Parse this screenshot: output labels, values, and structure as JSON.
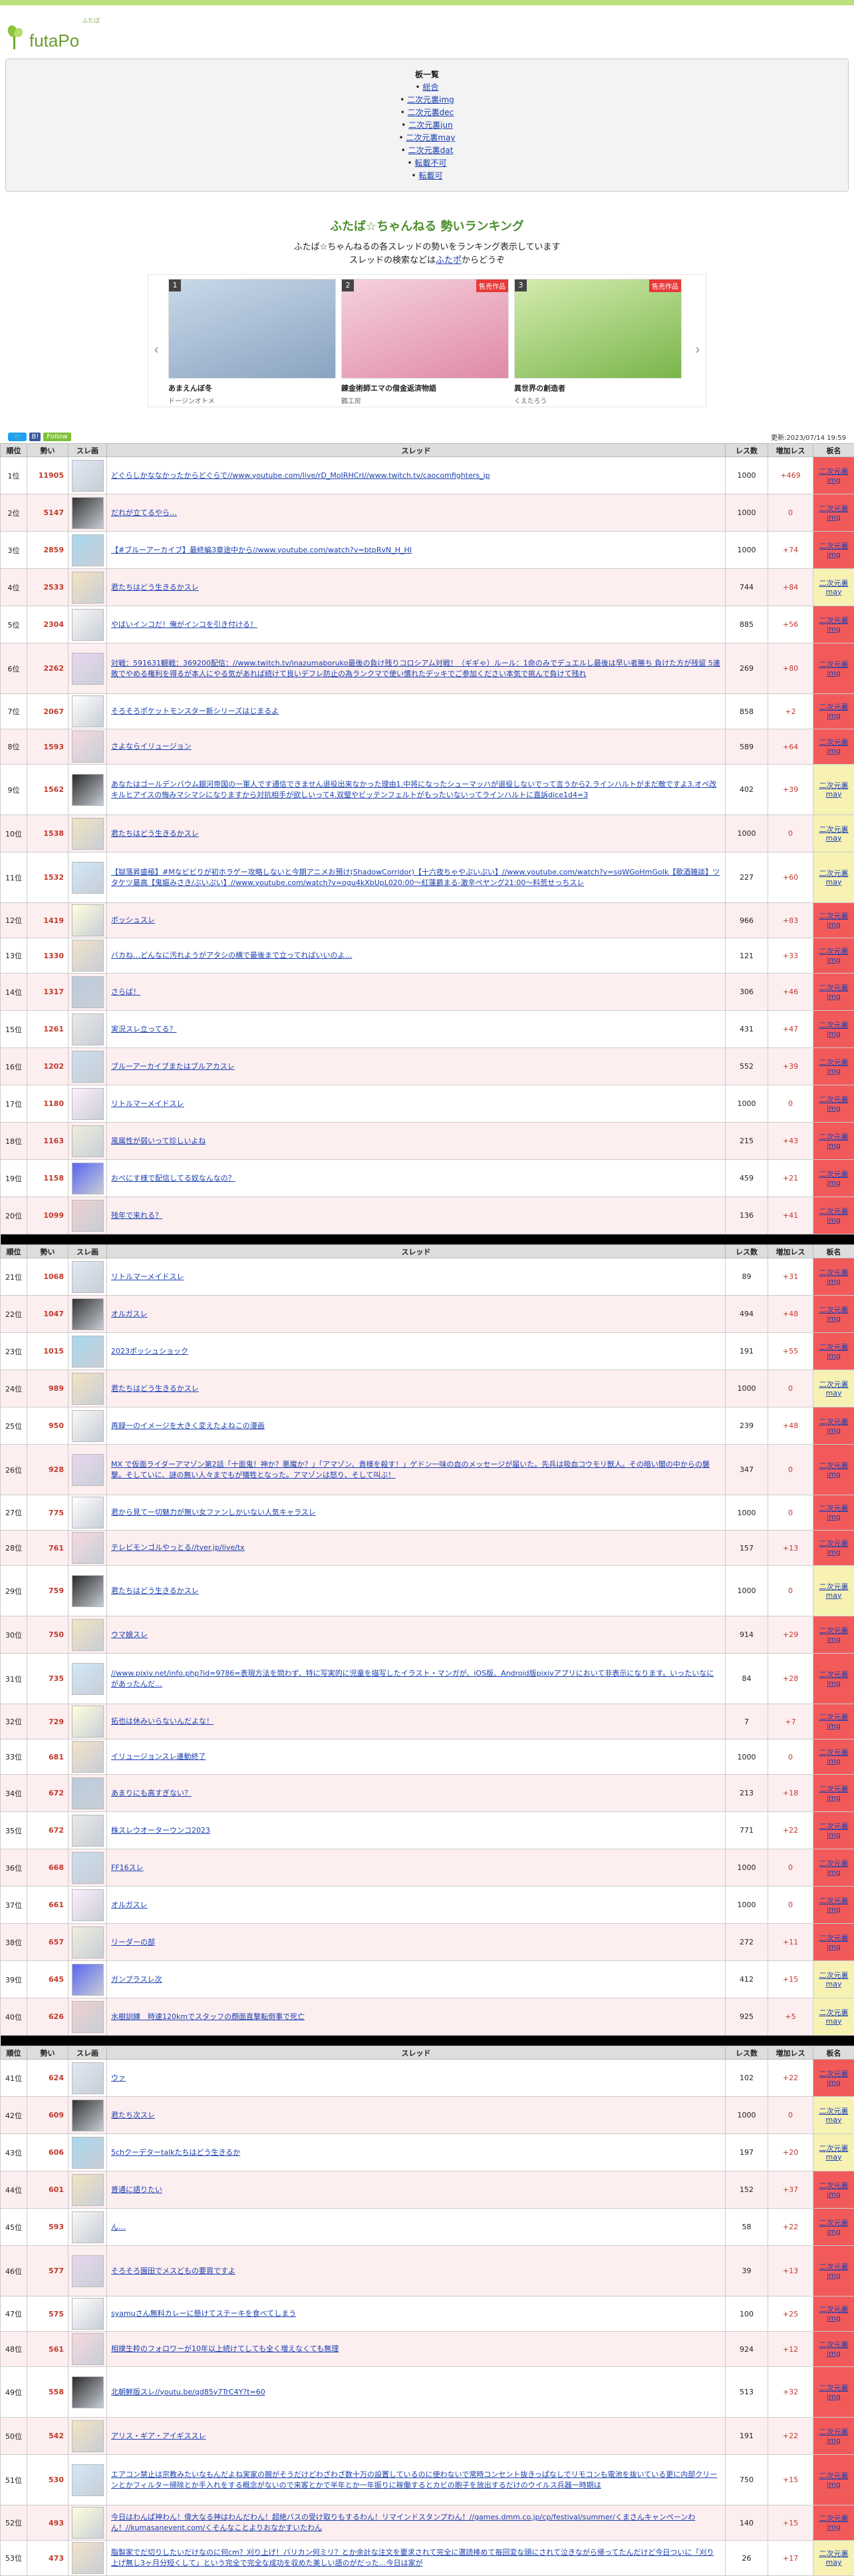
{
  "site": {
    "logo_text": "futaPo",
    "logo_tag": "ふたぽ"
  },
  "menu": {
    "title": "板一覧",
    "items": [
      "総合",
      "二次元裏img",
      "二次元裏dec",
      "二次元裏jun",
      "二次元裏may",
      "二次元裏dat",
      "転載不可",
      "転載可"
    ]
  },
  "ranking": {
    "title": "ふたば☆ちゃんねる 勢いランキング",
    "desc1": "ふたば☆ちゃんねるの各スレッドの勢いをランキング表示しています",
    "desc2_pre": "スレッドの検索などは",
    "desc2_link": "ふたポ",
    "desc2_post": "からどうぞ"
  },
  "carousel": {
    "prev_icon": "chevron-left-icon",
    "next_icon": "chevron-right-icon",
    "cards": [
      {
        "num": "1",
        "title": "あまえんぼ冬",
        "sub": "ドージンオトメ",
        "badge": ""
      },
      {
        "num": "2",
        "title": "錬金術師エマの借金返済物語",
        "sub": "鶴工房",
        "badge": "售売作品"
      },
      {
        "num": "3",
        "title": "異世界の創造者",
        "sub": "くえたろう",
        "badge": "售売作品"
      }
    ]
  },
  "toolbar": {
    "tweet": "",
    "b": "B!",
    "follow": "Follow",
    "updated": "更新:2023/07/14 19:59"
  },
  "table": {
    "headers": [
      "順位",
      "勢い",
      "スレ画",
      "スレッド",
      "レス数",
      "増加レス",
      "板名"
    ]
  },
  "rows": [
    {
      "rank": "1位",
      "ikioi": "11905",
      "title": "どぐらしかななかったからどぐらで//www.youtube.com/live/rD_MoIRHCrI//www.twitch.tv/caocomfighters_jp",
      "res": "1000",
      "inc": "+469",
      "board": "二次元裏img"
    },
    {
      "rank": "2位",
      "ikioi": "5147",
      "title": "だれが立てるやら…",
      "res": "1000",
      "inc": "0",
      "board": "二次元裏img"
    },
    {
      "rank": "3位",
      "ikioi": "2859",
      "title": "【#ブルーアーカイブ】最終編3章途中から//www.youtube.com/watch?v=btpRvN_H_HI",
      "res": "1000",
      "inc": "+74",
      "board": "二次元裏img"
    },
    {
      "rank": "4位",
      "ikioi": "2533",
      "title": "君たちはどう生きるかスレ",
      "res": "744",
      "inc": "+84",
      "board": "二次元裏may"
    },
    {
      "rank": "5位",
      "ikioi": "2304",
      "title": "やばいインコだ！俺がインコを引き付ける！",
      "res": "885",
      "inc": "+56",
      "board": "二次元裏img"
    },
    {
      "rank": "6位",
      "ikioi": "2262",
      "title": "対戦：591631観戦：369200配信：//www.twitch.tv/inazumaboruko最後の負け残りコロシアム対戦！（ギギゃ）ルール：1命のみでデュエルし最後は早い者勝ち 負けた方が残留 5連敗でやめる権利を得るが本人にやる気があれば続けて良いデフレ防止の為ランクマで使い慣れたデッキでご参加ください本気で挑んで負けて残れ",
      "res": "269",
      "inc": "+80",
      "board": "二次元裏img"
    },
    {
      "rank": "7位",
      "ikioi": "2067",
      "title": "そろそろポケットモンスター新シリーズはじまるよ",
      "res": "858",
      "inc": "+2",
      "board": "二次元裏img"
    },
    {
      "rank": "8位",
      "ikioi": "1593",
      "title": "さよならイリュージョン",
      "res": "589",
      "inc": "+64",
      "board": "二次元裏img"
    },
    {
      "rank": "9位",
      "ikioi": "1562",
      "title": "あなたはゴールデンバウム銀河帝国の一軍人です通信できません退役出来なかった理由1.中将になったシューマッハが退役しないでって言うから2.ラインハルトがまだ敵ですよ3.オペ改キルヒアイスの悔みマシマシになりますから対抗相手が欲しいって4.双璧やビッテンフェルトがもったいないってラインハルトに直訴dice1d4=3",
      "res": "402",
      "inc": "+39",
      "board": "二次元裏may"
    },
    {
      "rank": "10位",
      "ikioi": "1538",
      "title": "君たちはどう生きるかスレ",
      "res": "1000",
      "inc": "0",
      "board": "二次元裏may"
    },
    {
      "rank": "11位",
      "ikioi": "1532",
      "title": "【獄落昇盛極】#Mなビビりが初ホラゲー攻略しないと今期アニメお預け(ShadowCorridor)【十六夜ちゃやぷいぷい】//www.youtube.com/watch?v=sqWGoHmGoIk【歌酒雑談】ツタケツ最高【鬼嫗みさき/ぶいぷい】//www.youtube.com/watch?v=ogu4kXbUpL020:00～紅蓮爵まる-激辛ペヤング21:00～料荒せっちスレ",
      "res": "227",
      "inc": "+60",
      "board": "二次元裏may"
    },
    {
      "rank": "12位",
      "ikioi": "1419",
      "title": "ボッシュスレ",
      "res": "966",
      "inc": "+83",
      "board": "二次元裏img"
    },
    {
      "rank": "13位",
      "ikioi": "1330",
      "title": "バカね…どんなに汚れようがアタシの横で最後まで立ってればいいのよ…",
      "res": "121",
      "inc": "+33",
      "board": "二次元裏img"
    },
    {
      "rank": "14位",
      "ikioi": "1317",
      "title": "さらば！",
      "res": "306",
      "inc": "+46",
      "board": "二次元裏img"
    },
    {
      "rank": "15位",
      "ikioi": "1261",
      "title": "実況スレ立ってる？",
      "res": "431",
      "inc": "+47",
      "board": "二次元裏img"
    },
    {
      "rank": "16位",
      "ikioi": "1202",
      "title": "ブルーアーカイブまたはブルアカスレ",
      "res": "552",
      "inc": "+39",
      "board": "二次元裏img"
    },
    {
      "rank": "17位",
      "ikioi": "1180",
      "title": "リトルマーメイドスレ",
      "res": "1000",
      "inc": "0",
      "board": "二次元裏img"
    },
    {
      "rank": "18位",
      "ikioi": "1163",
      "title": "風属性が弱いって珍しいよね",
      "res": "215",
      "inc": "+43",
      "board": "二次元裏img"
    },
    {
      "rank": "19位",
      "ikioi": "1158",
      "title": "おぺにす様で配信してる奴なんなの？",
      "res": "459",
      "inc": "+21",
      "board": "二次元裏img"
    },
    {
      "rank": "20位",
      "ikioi": "1099",
      "title": "残年で来れる？",
      "res": "136",
      "inc": "+41",
      "board": "二次元裏img"
    },
    {
      "rank": "21位",
      "ikioi": "1068",
      "title": "リトルマーメイドスレ",
      "res": "89",
      "inc": "+31",
      "board": "二次元裏img"
    },
    {
      "rank": "22位",
      "ikioi": "1047",
      "title": "オルガスレ",
      "res": "494",
      "inc": "+48",
      "board": "二次元裏img"
    },
    {
      "rank": "23位",
      "ikioi": "1015",
      "title": "2023ボッシュショック",
      "res": "191",
      "inc": "+55",
      "board": "二次元裏img"
    },
    {
      "rank": "24位",
      "ikioi": "989",
      "title": "君たちはどう生きるかスレ",
      "res": "1000",
      "inc": "0",
      "board": "二次元裏may"
    },
    {
      "rank": "25位",
      "ikioi": "950",
      "title": "再録一のイメージを大きく変えたよねこの漫画",
      "res": "239",
      "inc": "+48",
      "board": "二次元裏img"
    },
    {
      "rank": "26位",
      "ikioi": "928",
      "title": "MX で仮面ライダーアマゾン第2話「十面鬼！神か？悪魔か？」「アマゾン、貴様を殺す！」ゲドン一味の血のメッセージが届いた。先兵は吸血コウモリ獣人。その暗い闇の中からの襲撃。そしていに、謎の無い人々までもが犠牲となった。アマゾンは怒り、そして叫ぶ！",
      "res": "347",
      "inc": "0",
      "board": "二次元裏img"
    },
    {
      "rank": "27位",
      "ikioi": "775",
      "title": "君から見て一切魅力が無い女ファンしかいない人気キャラスレ",
      "res": "1000",
      "inc": "0",
      "board": "二次元裏img"
    },
    {
      "rank": "28位",
      "ikioi": "761",
      "title": "テレビモンゴルやっとる//tver.jp/live/tx",
      "res": "157",
      "inc": "+13",
      "board": "二次元裏img"
    },
    {
      "rank": "29位",
      "ikioi": "759",
      "title": "君たちはどう生きるかスレ",
      "res": "1000",
      "inc": "0",
      "board": "二次元裏may"
    },
    {
      "rank": "30位",
      "ikioi": "750",
      "title": "ウマ娘スレ",
      "res": "914",
      "inc": "+29",
      "board": "二次元裏img"
    },
    {
      "rank": "31位",
      "ikioi": "735",
      "title": "//www.pixiv.net/info.php?id=9786=表現方法を問わず、特に写実的に児童を描写したイラスト・マンガが、iOS版、Android版pixivアプリにおいて非表示になります。いったいなにがあったんだ…",
      "res": "84",
      "inc": "+28",
      "board": "二次元裏img"
    },
    {
      "rank": "32位",
      "ikioi": "729",
      "title": "拓也は休みいらないんだよな！",
      "res": "7",
      "inc": "+7",
      "board": "二次元裏img"
    },
    {
      "rank": "33位",
      "ikioi": "681",
      "title": "イリュージョンスレ連動終了",
      "res": "1000",
      "inc": "0",
      "board": "二次元裏img"
    },
    {
      "rank": "34位",
      "ikioi": "672",
      "title": "あまりにも高すぎない？",
      "res": "213",
      "inc": "+18",
      "board": "二次元裏img"
    },
    {
      "rank": "35位",
      "ikioi": "672",
      "title": "株スレウオーターウンコ2023",
      "res": "771",
      "inc": "+22",
      "board": "二次元裏img"
    },
    {
      "rank": "36位",
      "ikioi": "668",
      "title": "FF16スレ",
      "res": "1000",
      "inc": "0",
      "board": "二次元裏img"
    },
    {
      "rank": "37位",
      "ikioi": "661",
      "title": "オルガスレ",
      "res": "1000",
      "inc": "0",
      "board": "二次元裏img"
    },
    {
      "rank": "38位",
      "ikioi": "657",
      "title": "リーダーの部",
      "res": "272",
      "inc": "+11",
      "board": "二次元裏img"
    },
    {
      "rank": "39位",
      "ikioi": "645",
      "title": "ガンプラスレ次",
      "res": "412",
      "inc": "+15",
      "board": "二次元裏may"
    },
    {
      "rank": "40位",
      "ikioi": "626",
      "title": "水樹訓練　時速120kmでスタッフの顔面直撃転倒事で死亡",
      "res": "925",
      "inc": "+5",
      "board": "二次元裏may"
    },
    {
      "rank": "41位",
      "ikioi": "624",
      "title": "ウァ",
      "res": "102",
      "inc": "+22",
      "board": "二次元裏img"
    },
    {
      "rank": "42位",
      "ikioi": "609",
      "title": "君たち次スレ",
      "res": "1000",
      "inc": "0",
      "board": "二次元裏may"
    },
    {
      "rank": "43位",
      "ikioi": "606",
      "title": "5chクーデターtalkたちはどう生きるか",
      "res": "197",
      "inc": "+20",
      "board": "二次元裏may"
    },
    {
      "rank": "44位",
      "ikioi": "601",
      "title": "普通に語りたい",
      "res": "152",
      "inc": "+37",
      "board": "二次元裏img"
    },
    {
      "rank": "45位",
      "ikioi": "593",
      "title": "ん…",
      "res": "58",
      "inc": "+22",
      "board": "二次元裏img"
    },
    {
      "rank": "46位",
      "ikioi": "577",
      "title": "そろそろ園田でメスどもの要買ですよ",
      "res": "39",
      "inc": "+13",
      "board": "二次元裏img"
    },
    {
      "rank": "47位",
      "ikioi": "575",
      "title": "syamuさん無料カレーに懸けてステーキを食べてしまう",
      "res": "100",
      "inc": "+25",
      "board": "二次元裏img"
    },
    {
      "rank": "48位",
      "ikioi": "561",
      "title": "相撲生粋のフォロワーが10年以上続けてしても全く増えなくても無理",
      "res": "924",
      "inc": "+12",
      "board": "二次元裏img"
    },
    {
      "rank": "49位",
      "ikioi": "558",
      "title": "北朝鮮版スレ//youtu.be/qd85y7TrC4Y?t=60",
      "res": "513",
      "inc": "+32",
      "board": "二次元裏img"
    },
    {
      "rank": "50位",
      "ikioi": "542",
      "title": "アリス・ギア・アイギススレ",
      "res": "191",
      "inc": "+22",
      "board": "二次元裏img"
    },
    {
      "rank": "51位",
      "ikioi": "530",
      "title": "エアコン禁止は宗教みたいなもんだよね実家の親がそうだけどわざわざ数十万の設置しているのに使わないで常時コンセント抜きっぱなしでリモコンも電池を抜いている更に内部クリーンとかフィルター掃除とか手入れをする概念がないので来客とかで半年とか一年振りに稼働するとカビの胞子を放出するだけのウイルス兵器一時期は",
      "res": "750",
      "inc": "+15",
      "board": "二次元裏img"
    },
    {
      "rank": "52位",
      "ikioi": "493",
      "title": "今日はわんぱ神わん！偉大なる神はわんだわん！超絶バスの受け取りもするわん！リマインドスタンプわん！//games.dmm.co.jp/cp/festival/summer/くまさんキャンペーンわん！//kumasanevent.com/くそんなことよりおなかすいたわん",
      "res": "140",
      "inc": "+15",
      "board": "二次元裏img"
    },
    {
      "rank": "53位",
      "ikioi": "473",
      "title": "脂製家でだ切りしたいだけなのに何cm？刈り上げ！バリカン何ミリ？とか余計な注文を要求されて完全に選読棒めて毎回変な頭にされて泣きながら帰ってたんだけど今日ついに「刈り上げ無し3ヶ月分短くして」という完全で完全な成功を収めた美しい語のがだった…今日は家が",
      "res": "26",
      "inc": "+17",
      "board": "二次元裏may"
    }
  ]
}
